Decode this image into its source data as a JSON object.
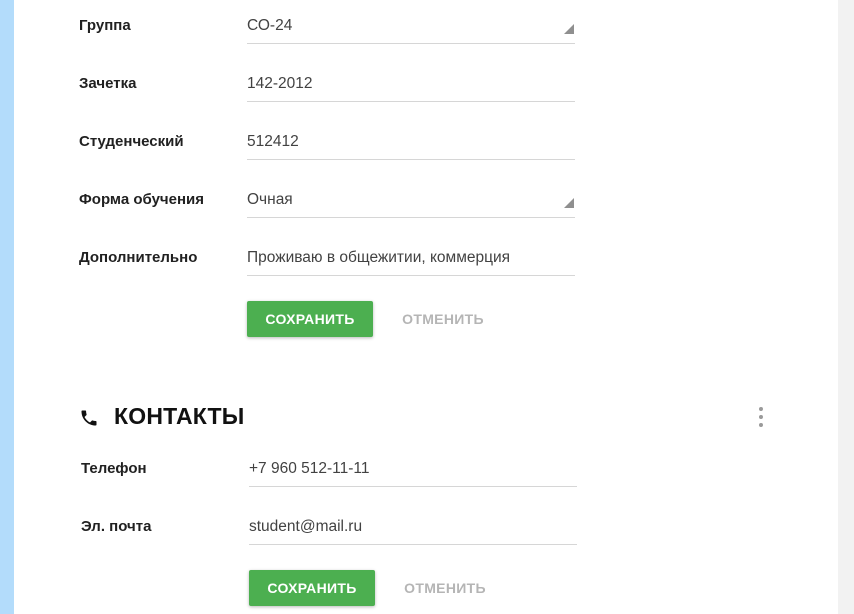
{
  "colors": {
    "accent_green": "#4caf50",
    "side_strip": "#b3dcfb",
    "cancel_text": "#b5b5b5"
  },
  "profile": {
    "fields": [
      {
        "label": "Группа",
        "value": "СО-24",
        "type": "select"
      },
      {
        "label": "Зачетка",
        "value": "142-2012",
        "type": "text"
      },
      {
        "label": "Студенческий",
        "value": "512412",
        "type": "text"
      },
      {
        "label": "Форма обучения",
        "value": "Очная",
        "type": "select"
      },
      {
        "label": "Дополнительно",
        "value": "Проживаю в общежитии, коммерция",
        "type": "text"
      }
    ],
    "save_label": "СОХРАНИТЬ",
    "cancel_label": "ОТМЕНИТЬ"
  },
  "contacts": {
    "title": "КОНТАКТЫ",
    "icon": "phone-icon",
    "menu_icon": "more-vert-icon",
    "fields": [
      {
        "label": "Телефон",
        "value": "+7 960 512-11-11",
        "type": "text"
      },
      {
        "label": "Эл. почта",
        "value": "student@mail.ru",
        "type": "text"
      }
    ],
    "save_label": "СОХРАНИТЬ",
    "cancel_label": "ОТМЕНИТЬ"
  }
}
